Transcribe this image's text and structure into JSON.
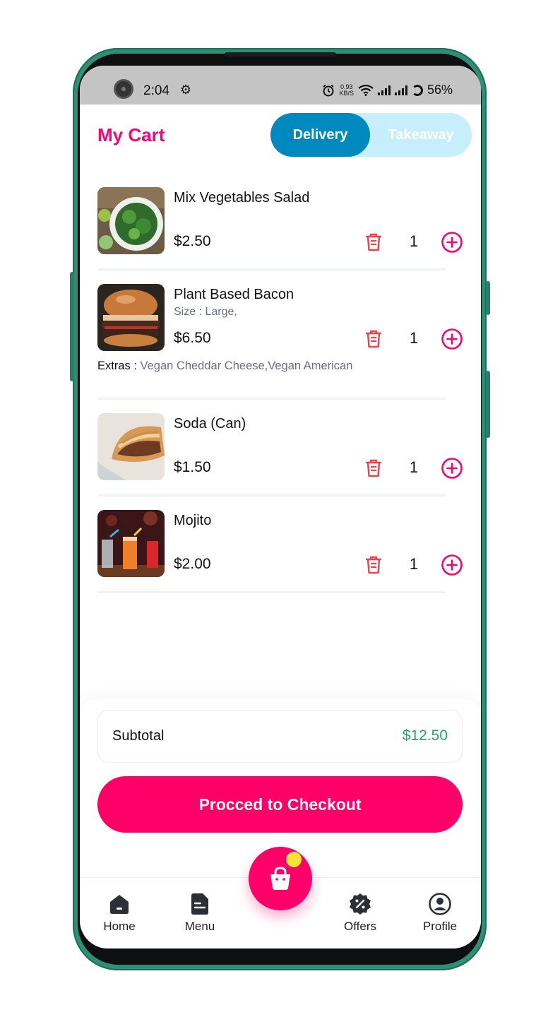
{
  "status_bar": {
    "time": "2:04",
    "net_speed_value": "0.93",
    "net_speed_unit": "KB/S",
    "battery": "56%"
  },
  "header": {
    "title": "My Cart",
    "toggle": {
      "active": "Delivery",
      "inactive": "Takeaway"
    }
  },
  "cart": {
    "items": [
      {
        "name": "Mix Vegetables Salad",
        "price": "$2.50",
        "qty": "1",
        "image_icon": "salad-image"
      },
      {
        "name": "Plant Based Bacon",
        "size": "Size : Large,",
        "price": "$6.50",
        "qty": "1",
        "extras_label": "Extras :",
        "extras_value": "Vegan Cheddar Cheese,Vegan American",
        "image_icon": "burger-image"
      },
      {
        "name": "Soda (Can)",
        "price": "$1.50",
        "qty": "1",
        "image_icon": "sandwich-image"
      },
      {
        "name": "Mojito",
        "price": "$2.00",
        "qty": "1",
        "image_icon": "cocktail-image"
      }
    ]
  },
  "summary": {
    "subtotal_label": "Subtotal",
    "subtotal_value": "$12.50",
    "checkout_label": "Procced to Checkout"
  },
  "nav": {
    "items": [
      {
        "label": "Home",
        "icon": "home-icon"
      },
      {
        "label": "Menu",
        "icon": "menu-icon"
      },
      {
        "label": "Offers",
        "icon": "offers-icon"
      },
      {
        "label": "Profile",
        "icon": "profile-icon"
      }
    ],
    "center_icon": "cart-bag-icon"
  },
  "colors": {
    "brand_pink": "#ff0068",
    "title_pink": "#f0087a",
    "toggle_active": "#0089bf",
    "toggle_bg": "#c7eefc",
    "subtotal_green": "#21a567",
    "trash_red": "#e8434f"
  }
}
